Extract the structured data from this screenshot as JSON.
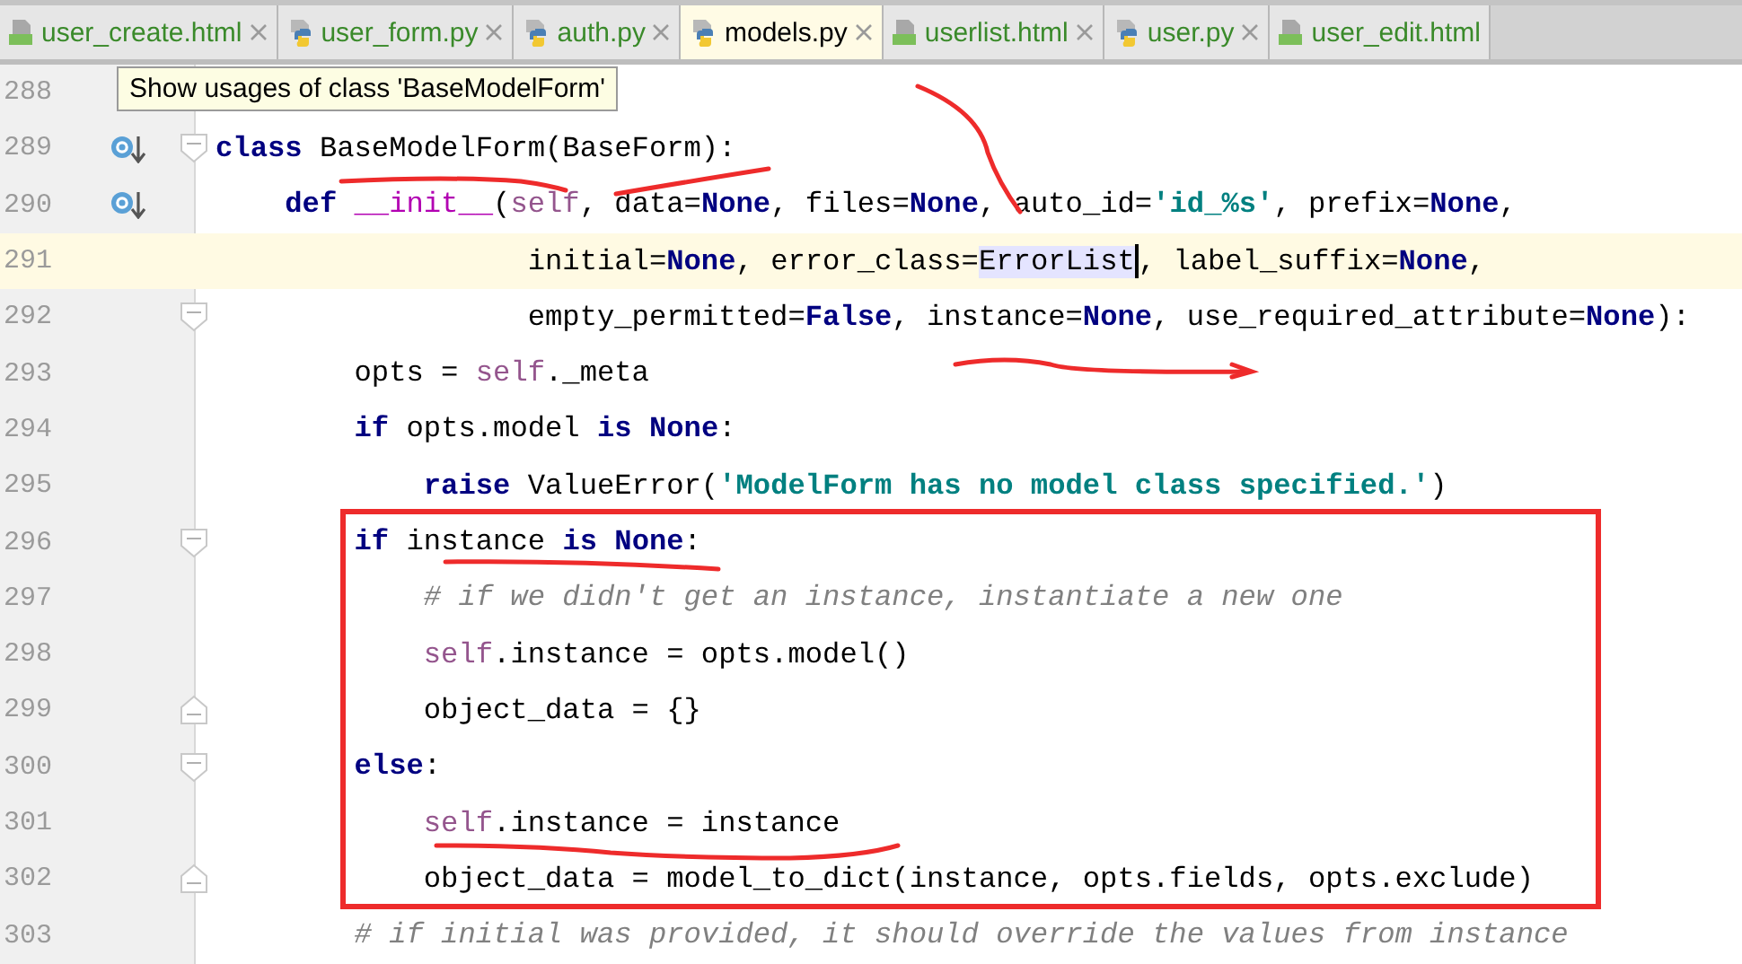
{
  "tabs": [
    {
      "label": "user_create.html",
      "kind": "html",
      "color": "#3a8a2a",
      "selected": false,
      "closable": true
    },
    {
      "label": "user_form.py",
      "kind": "python",
      "color": "#3a8a2a",
      "selected": false,
      "closable": true
    },
    {
      "label": "auth.py",
      "kind": "python",
      "color": "#3a8a2a",
      "selected": false,
      "closable": true
    },
    {
      "label": "models.py",
      "kind": "python",
      "color": "#000000",
      "selected": true,
      "closable": true
    },
    {
      "label": "userlist.html",
      "kind": "html",
      "color": "#3a8a2a",
      "selected": false,
      "closable": true
    },
    {
      "label": "user.py",
      "kind": "python",
      "color": "#3a8a2a",
      "selected": false,
      "closable": true
    },
    {
      "label": "user_edit.html",
      "kind": "html",
      "color": "#3a8a2a",
      "selected": false,
      "closable": false
    }
  ],
  "tooltip": {
    "text": "Show usages of class 'BaseModelForm'"
  },
  "lines": [
    {
      "number": "288",
      "current": false
    },
    {
      "number": "289",
      "current": false,
      "icons": [
        {
          "kind": "override"
        },
        {
          "kind": "fold_start"
        }
      ],
      "tokens": [
        {
          "t": "class",
          "kind": "kw"
        },
        {
          "t": " BaseModelForm(BaseForm):",
          "kind": "plain"
        }
      ]
    },
    {
      "number": "290",
      "current": false,
      "icons": [
        {
          "kind": "override"
        }
      ],
      "tokens": [
        {
          "t": "    def",
          "kind": "kw"
        },
        {
          "t": " __init__",
          "kind": "magic"
        },
        {
          "t": "(",
          "kind": "plain"
        },
        {
          "t": "self",
          "kind": "self"
        },
        {
          "t": ", data=",
          "kind": "plain"
        },
        {
          "t": "None",
          "kind": "kw"
        },
        {
          "t": ", files=",
          "kind": "plain"
        },
        {
          "t": "None",
          "kind": "kw"
        },
        {
          "t": ", auto_id=",
          "kind": "plain"
        },
        {
          "t": "'id_%s'",
          "kind": "str"
        },
        {
          "t": ", prefix=",
          "kind": "plain"
        },
        {
          "t": "None",
          "kind": "kw"
        },
        {
          "t": ",",
          "kind": "plain"
        }
      ]
    },
    {
      "number": "291",
      "current": true,
      "tokens": [
        {
          "t": "                  initial=",
          "kind": "plain"
        },
        {
          "t": "None",
          "kind": "kw"
        },
        {
          "t": ", error_class=",
          "kind": "plain"
        },
        {
          "t": "ErrorList",
          "kind": "usage",
          "caret": true
        },
        {
          "t": ", label_suffix=",
          "kind": "plain"
        },
        {
          "t": "None",
          "kind": "kw"
        },
        {
          "t": ",",
          "kind": "plain"
        }
      ]
    },
    {
      "number": "292",
      "current": false,
      "icons": [
        {
          "kind": "fold_start"
        }
      ],
      "tokens": [
        {
          "t": "                  empty_permitted=",
          "kind": "plain"
        },
        {
          "t": "False",
          "kind": "kw"
        },
        {
          "t": ", instance=",
          "kind": "plain"
        },
        {
          "t": "None",
          "kind": "kw"
        },
        {
          "t": ", use_required_attribute=",
          "kind": "plain"
        },
        {
          "t": "None",
          "kind": "kw"
        },
        {
          "t": "):",
          "kind": "plain"
        }
      ]
    },
    {
      "number": "293",
      "current": false,
      "tokens": [
        {
          "t": "        opts = ",
          "kind": "plain"
        },
        {
          "t": "self",
          "kind": "self"
        },
        {
          "t": "._meta",
          "kind": "plain"
        }
      ]
    },
    {
      "number": "294",
      "current": false,
      "tokens": [
        {
          "t": "        if",
          "kind": "kw"
        },
        {
          "t": " opts.model ",
          "kind": "plain"
        },
        {
          "t": "is None",
          "kind": "kw"
        },
        {
          "t": ":",
          "kind": "plain"
        }
      ]
    },
    {
      "number": "295",
      "current": false,
      "tokens": [
        {
          "t": "            raise",
          "kind": "kw"
        },
        {
          "t": " ValueError(",
          "kind": "plain"
        },
        {
          "t": "'ModelForm has no model class specified.'",
          "kind": "str"
        },
        {
          "t": ")",
          "kind": "plain"
        }
      ]
    },
    {
      "number": "296",
      "current": false,
      "icons": [
        {
          "kind": "fold_start"
        }
      ],
      "tokens": [
        {
          "t": "        if",
          "kind": "kw"
        },
        {
          "t": " instance ",
          "kind": "plain"
        },
        {
          "t": "is None",
          "kind": "kw"
        },
        {
          "t": ":",
          "kind": "plain"
        }
      ]
    },
    {
      "number": "297",
      "current": false,
      "tokens": [
        {
          "t": "            # if we didn't get an instance, instantiate a new one",
          "kind": "comment"
        }
      ]
    },
    {
      "number": "298",
      "current": false,
      "tokens": [
        {
          "t": "            self",
          "kind": "self"
        },
        {
          "t": ".instance = opts.model()",
          "kind": "plain"
        }
      ]
    },
    {
      "number": "299",
      "current": false,
      "icons": [
        {
          "kind": "fold_end"
        }
      ],
      "tokens": [
        {
          "t": "            object_data = {}",
          "kind": "plain"
        }
      ]
    },
    {
      "number": "300",
      "current": false,
      "icons": [
        {
          "kind": "fold_start"
        }
      ],
      "tokens": [
        {
          "t": "        else",
          "kind": "kw"
        },
        {
          "t": ":",
          "kind": "plain"
        }
      ]
    },
    {
      "number": "301",
      "current": false,
      "tokens": [
        {
          "t": "            self",
          "kind": "self"
        },
        {
          "t": ".instance = instance",
          "kind": "plain"
        }
      ]
    },
    {
      "number": "302",
      "current": false,
      "icons": [
        {
          "kind": "fold_end"
        }
      ],
      "tokens": [
        {
          "t": "            object_data = model_to_dict(instance, opts.fields, opts.exclude)",
          "kind": "plain"
        }
      ]
    },
    {
      "number": "303",
      "current": false,
      "tokens": [
        {
          "t": "        # if initial was provided, it should override the values from instance",
          "kind": "comment"
        }
      ]
    }
  ]
}
